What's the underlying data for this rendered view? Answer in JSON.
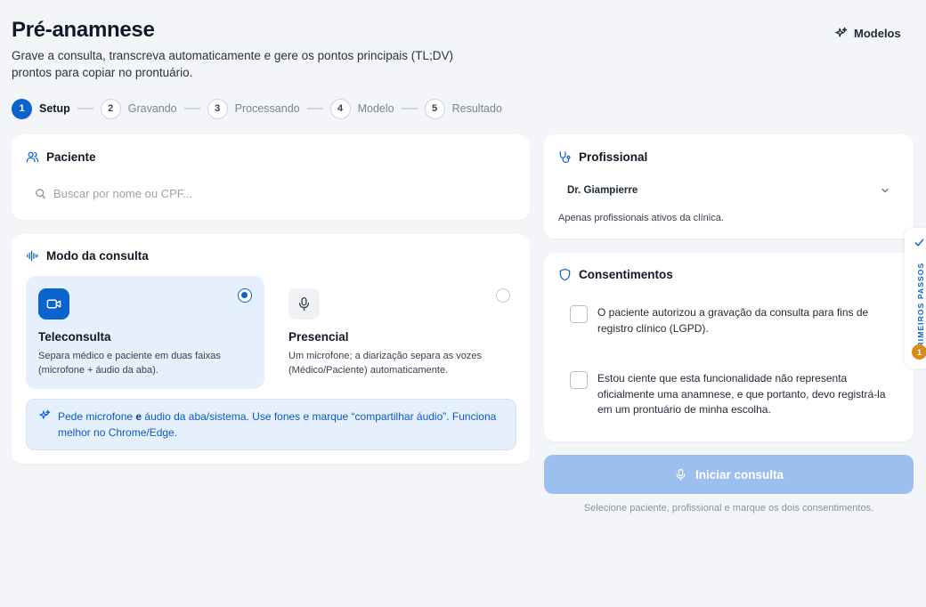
{
  "header": {
    "title": "Pré-anamnese",
    "subtitle": "Grave a consulta, transcreva automaticamente e gere os pontos principais (TL;DV) pronto​s para copiar no prontuário.",
    "models_label": "Modelos"
  },
  "stepper": {
    "steps": [
      {
        "num": "1",
        "label": "Setup"
      },
      {
        "num": "2",
        "label": "Gravando"
      },
      {
        "num": "3",
        "label": "Processando"
      },
      {
        "num": "4",
        "label": "Modelo"
      },
      {
        "num": "5",
        "label": "Resultado"
      }
    ],
    "active": "Setup"
  },
  "patient": {
    "title": "Paciente",
    "search_placeholder": "Buscar por nome ou CPF..."
  },
  "mode": {
    "title": "Modo da consulta",
    "options": [
      {
        "name": "Teleconsulta",
        "desc": "Separa médico e paciente em duas faixas (microfone + áudio da aba).",
        "selected": true
      },
      {
        "name": "Presencial",
        "desc": "Um microfone; a diarização separa as vozes (Médico/Paciente) automaticamente.",
        "selected": false
      }
    ],
    "info_prefix": "Pede microfone ",
    "info_bold": "e",
    "info_suffix": " áudio da aba/sistema. Use fones e marque “compartilhar áudio”. Funciona melhor no Chrome/Edge."
  },
  "professional": {
    "title": "Profissional",
    "selected": "Dr. Giampierre",
    "hint": "Apenas profissionais ativos da clínica."
  },
  "consents": {
    "title": "Consentimentos",
    "items": [
      {
        "text": "O paciente autorizou a gravação da consulta para fins de registro clínico (LGPD).",
        "checked": false
      },
      {
        "text": "Estou ciente que esta funcionalidade não representa oficialmente uma anamnese, e que portanto, devo registrá-la em um prontuário de minha escolha.",
        "checked": false
      }
    ]
  },
  "start": {
    "label": "Iniciar consulta",
    "hint": "Selecione paciente, profissional e marque os dois consentimentos."
  },
  "side_tab": {
    "label": "PRIMEIROS PASSOS",
    "badge": "1"
  },
  "colors": {
    "accent": "#0b63ce",
    "accent_light": "#e6effc",
    "disabled_button": "#9dbfef",
    "badge": "#d98c17",
    "background": "#f3f5f8"
  }
}
